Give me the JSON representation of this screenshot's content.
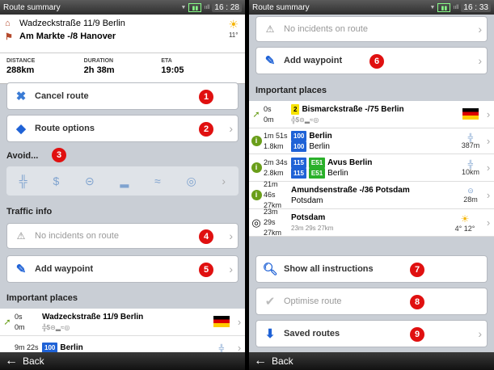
{
  "left": {
    "status": {
      "title": "Route summary",
      "time": "16 : 28"
    },
    "route": {
      "from": "Wadzeckstraße 11/9  Berlin",
      "to": "Am Markte -/8  Hanover",
      "temp": "11°"
    },
    "stats": [
      {
        "label": "DISTANCE",
        "value": "288km"
      },
      {
        "label": "DURATION",
        "value": "2h 38m"
      },
      {
        "label": "ETA",
        "value": "19:05"
      }
    ],
    "cancel": "Cancel route",
    "options": "Route options",
    "avoid": "Avoid...",
    "traffic_header": "Traffic info",
    "incidents": "No incidents on route",
    "add_waypoint": "Add waypoint",
    "places_header": "Important places",
    "places": [
      {
        "time": "0s",
        "dist": "0m",
        "name": "Wadzeckstraße 11/9  Berlin"
      },
      {
        "time": "9m 22s",
        "tag": "100",
        "name": "Berlin"
      }
    ],
    "back": "Back"
  },
  "right": {
    "status": {
      "title": "Route summary",
      "time": "16 : 33"
    },
    "incidents": "No incidents on route",
    "add_waypoint": "Add waypoint",
    "places_header": "Important places",
    "places": [
      {
        "time": "0s",
        "dist": "0m",
        "tag": "2",
        "name": "Bismarckstraße -/75  Berlin",
        "side": ""
      },
      {
        "time": "1m 51s",
        "dist": "1.8km",
        "tag": "100",
        "name": "Berlin",
        "sub_tag": "100",
        "sub": "Berlin",
        "side": "387m"
      },
      {
        "time": "2m 34s",
        "dist": "2.8km",
        "tag": "115",
        "tag2": "E51",
        "name": "Avus  Berlin",
        "sub_tag": "115",
        "sub_tag2": "E51",
        "sub": "Berlin",
        "side": "10km"
      },
      {
        "time": "21m 46s",
        "dist": "27km",
        "name": "Amundsenstraße -/36  Potsdam",
        "sub": "Potsdam",
        "side": "28m"
      },
      {
        "time": "23m 29s",
        "dist": "27km",
        "name": "Potsdam",
        "sub": "23m 29s   27km",
        "side": "4°   12°"
      }
    ],
    "show_all": "Show all instructions",
    "optimise": "Optimise route",
    "saved": "Saved routes",
    "back": "Back"
  },
  "badges": [
    "1",
    "2",
    "3",
    "4",
    "5",
    "6",
    "7",
    "8",
    "9"
  ]
}
